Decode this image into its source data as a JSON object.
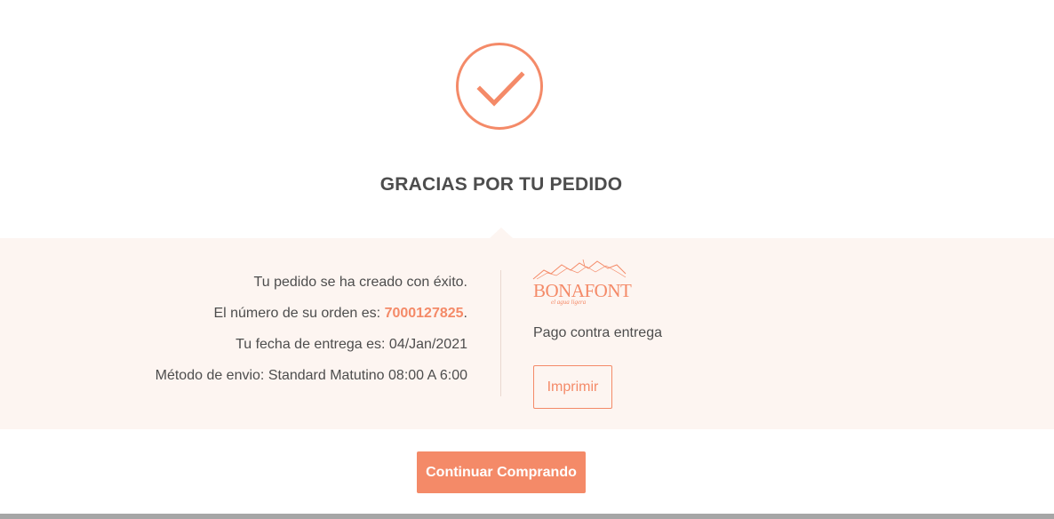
{
  "confirmation": {
    "icon": "checkmark-circle-icon",
    "title": "GRACIAS POR TU PEDIDO"
  },
  "order_details": {
    "created_text": "Tu pedido se ha creado con éxito.",
    "order_number_label": "El número de su orden es: ",
    "order_number": "7000127825",
    "order_number_suffix": ".",
    "delivery_date_text": "Tu fecha de entrega es: 04/Jan/2021",
    "shipping_method_text": "Método de envio: Standard Matutino 08:00 A 6:00"
  },
  "brand": {
    "logo_icon": "bonafont-logo",
    "name": "BONAFONT",
    "tagline": "el agua ligera"
  },
  "payment": {
    "method": "Pago contra entrega",
    "print_label": "Imprimir"
  },
  "actions": {
    "continue_label": "Continuar Comprando"
  },
  "colors": {
    "accent": "#f48a68",
    "panel_background": "#fdf5f1",
    "text": "#4d4d4d"
  }
}
